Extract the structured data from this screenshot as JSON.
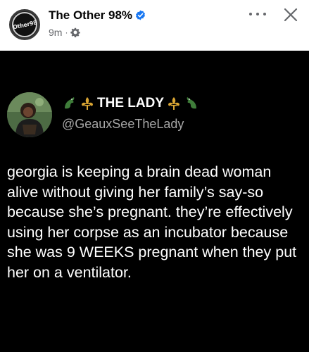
{
  "post_header": {
    "page_name": "The Other 98%",
    "avatar_text": "Other98",
    "time": "9m",
    "separator": "·"
  },
  "tweet": {
    "display_name": "THE LADY",
    "handle": "@GeauxSeeTheLady",
    "text": "georgia is keeping a brain dead woman alive without giving her family’s say-so because she’s pregnant. they’re effectively using her corpse as an incubator because she was 9 WEEKS pregnant when they put her on a ventilator."
  },
  "icons": [
    "verified-badge-icon",
    "gear-icon",
    "more-options-icon",
    "close-icon",
    "alligator-icon",
    "fleur-de-lis-icon"
  ],
  "colors": {
    "header_bg": "#ffffff",
    "post_bg": "#000000",
    "verified": "#1877f2",
    "handle_gray": "#a8a8a8",
    "meta_gray": "#65676b",
    "fleur_gold": "#d9a533",
    "gator_green": "#3f7d3a"
  }
}
